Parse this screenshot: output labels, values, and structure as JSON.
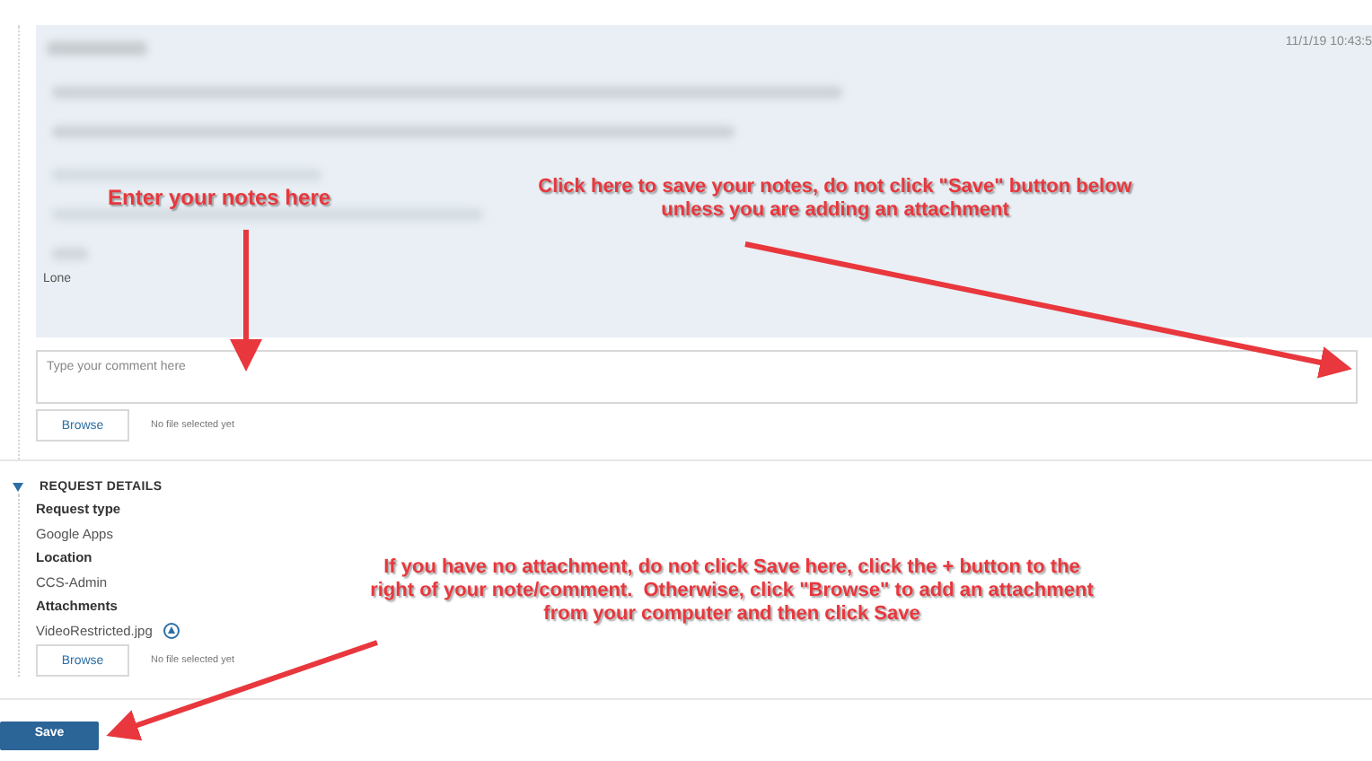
{
  "comment": {
    "timestamp": "11/1/19 10:43:5",
    "trailing_text": "Lone"
  },
  "new_comment": {
    "placeholder": "Type your comment here",
    "browse_button": "Browse",
    "file_status": "No file selected yet"
  },
  "request_details": {
    "title": "REQUEST DETAILS",
    "expanded": true,
    "fields": [
      {
        "label": "Request type",
        "value": "Google Apps"
      },
      {
        "label": "Location",
        "value": "CCS-Admin"
      }
    ],
    "attachments": {
      "label": "Attachments",
      "file": "VideoRestricted.jpg",
      "browse_button": "Browse",
      "file_status": "No file selected yet"
    }
  },
  "save_button": "Save",
  "annotations": [
    {
      "text": "Enter your notes here",
      "kind": "notes"
    },
    {
      "text": "Click here to save your notes, do not click \"Save\" button below unless you are adding an attachment",
      "kind": "plus"
    },
    {
      "text": "If you have no attachment, do not click Save here, click the + button to the right of your note/comment.  Otherwise, click \"Browse\" to add an attachment from your computer and then click Save",
      "kind": "save"
    }
  ]
}
